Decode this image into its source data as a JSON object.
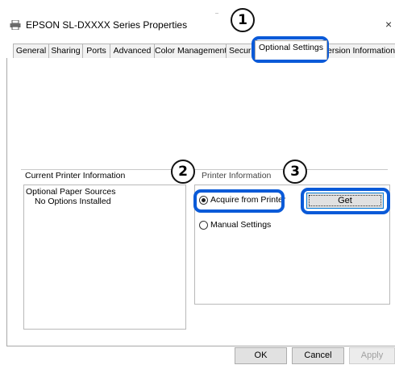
{
  "window": {
    "title": "EPSON SL-DXXXX Series Properties",
    "close_glyph": "×"
  },
  "tabs": [
    {
      "label": "General"
    },
    {
      "label": "Sharing"
    },
    {
      "label": "Ports"
    },
    {
      "label": "Advanced"
    },
    {
      "label": "Color Management"
    },
    {
      "label": "Securi"
    },
    {
      "label": "Optional Settings"
    },
    {
      "label": "ersion Information"
    }
  ],
  "active_tab": "Optional Settings",
  "current_printer_info": {
    "heading": "Current Printer Information",
    "lines": [
      "Optional Paper Sources",
      "No Options Installed"
    ]
  },
  "printer_information": {
    "heading": "Printer Information",
    "options": [
      {
        "label": "Acquire from Printer",
        "selected": true
      },
      {
        "label": "Manual Settings",
        "selected": false
      }
    ],
    "get_button": "Get"
  },
  "footer": {
    "ok": "OK",
    "cancel": "Cancel",
    "apply": "Apply"
  },
  "callouts": [
    "1",
    "2",
    "3"
  ],
  "colors": {
    "highlight": "#0a5ad8"
  }
}
